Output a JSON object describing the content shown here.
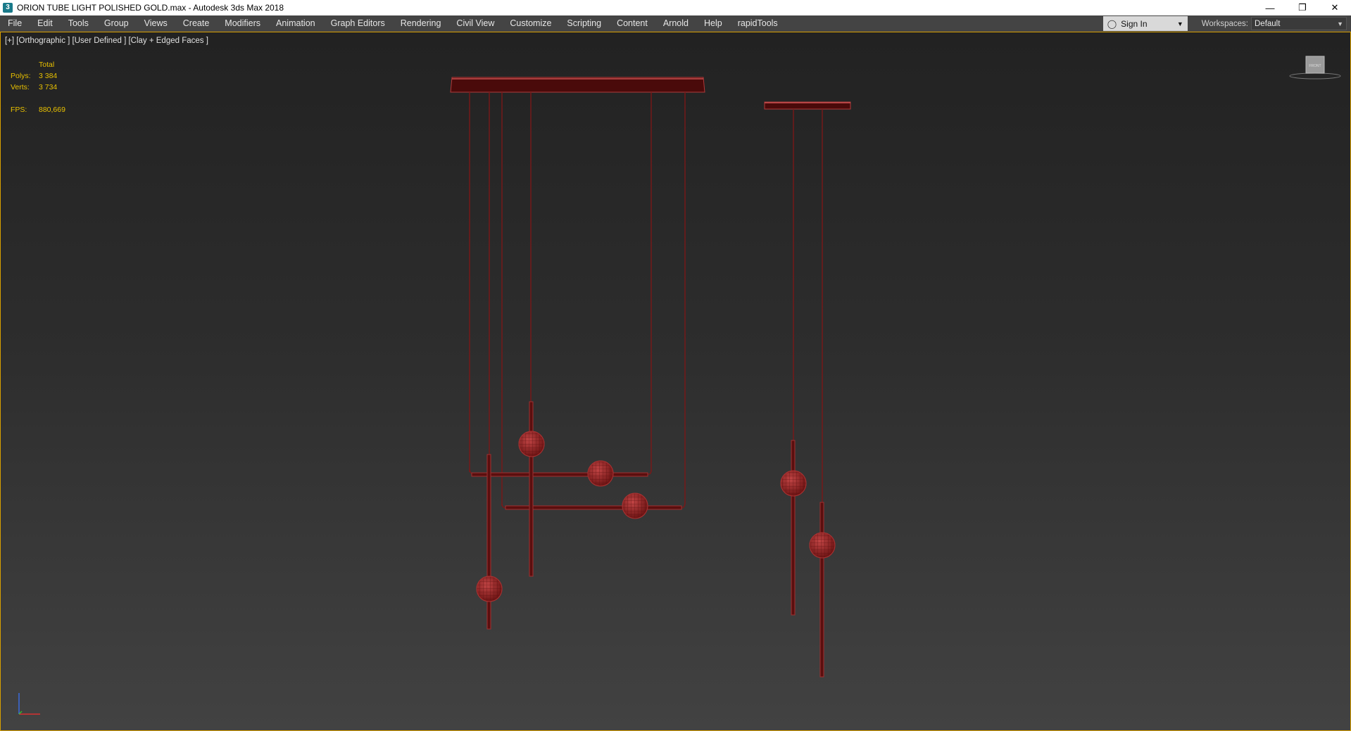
{
  "window": {
    "title": "ORION TUBE LIGHT POLISHED GOLD.max - Autodesk 3ds Max 2018",
    "icon": "3ds-max-app-icon",
    "minimize": "—",
    "restore": "❐",
    "close": "✕"
  },
  "menu": {
    "items": [
      "File",
      "Edit",
      "Tools",
      "Group",
      "Views",
      "Create",
      "Modifiers",
      "Animation",
      "Graph Editors",
      "Rendering",
      "Civil View",
      "Customize",
      "Scripting",
      "Content",
      "Arnold",
      "Help",
      "rapidTools"
    ],
    "signin_label": "Sign In",
    "workspaces_label": "Workspaces:",
    "workspace_value": "Default"
  },
  "viewport": {
    "label": "[+] [Orthographic ] [User Defined ] [Clay + Edged Faces ]",
    "stats": {
      "header": "Total",
      "polys_label": "Polys:",
      "polys_value": "3 384",
      "verts_label": "Verts:",
      "verts_value": "3 734",
      "fps_label": "FPS:",
      "fps_value": "880,669"
    },
    "viewcube_label": "FRONT",
    "colors": {
      "model": "#6e1414",
      "model_highlight": "#b03a3a",
      "stats_text": "#e8c000",
      "active_border": "#d8a000"
    }
  }
}
